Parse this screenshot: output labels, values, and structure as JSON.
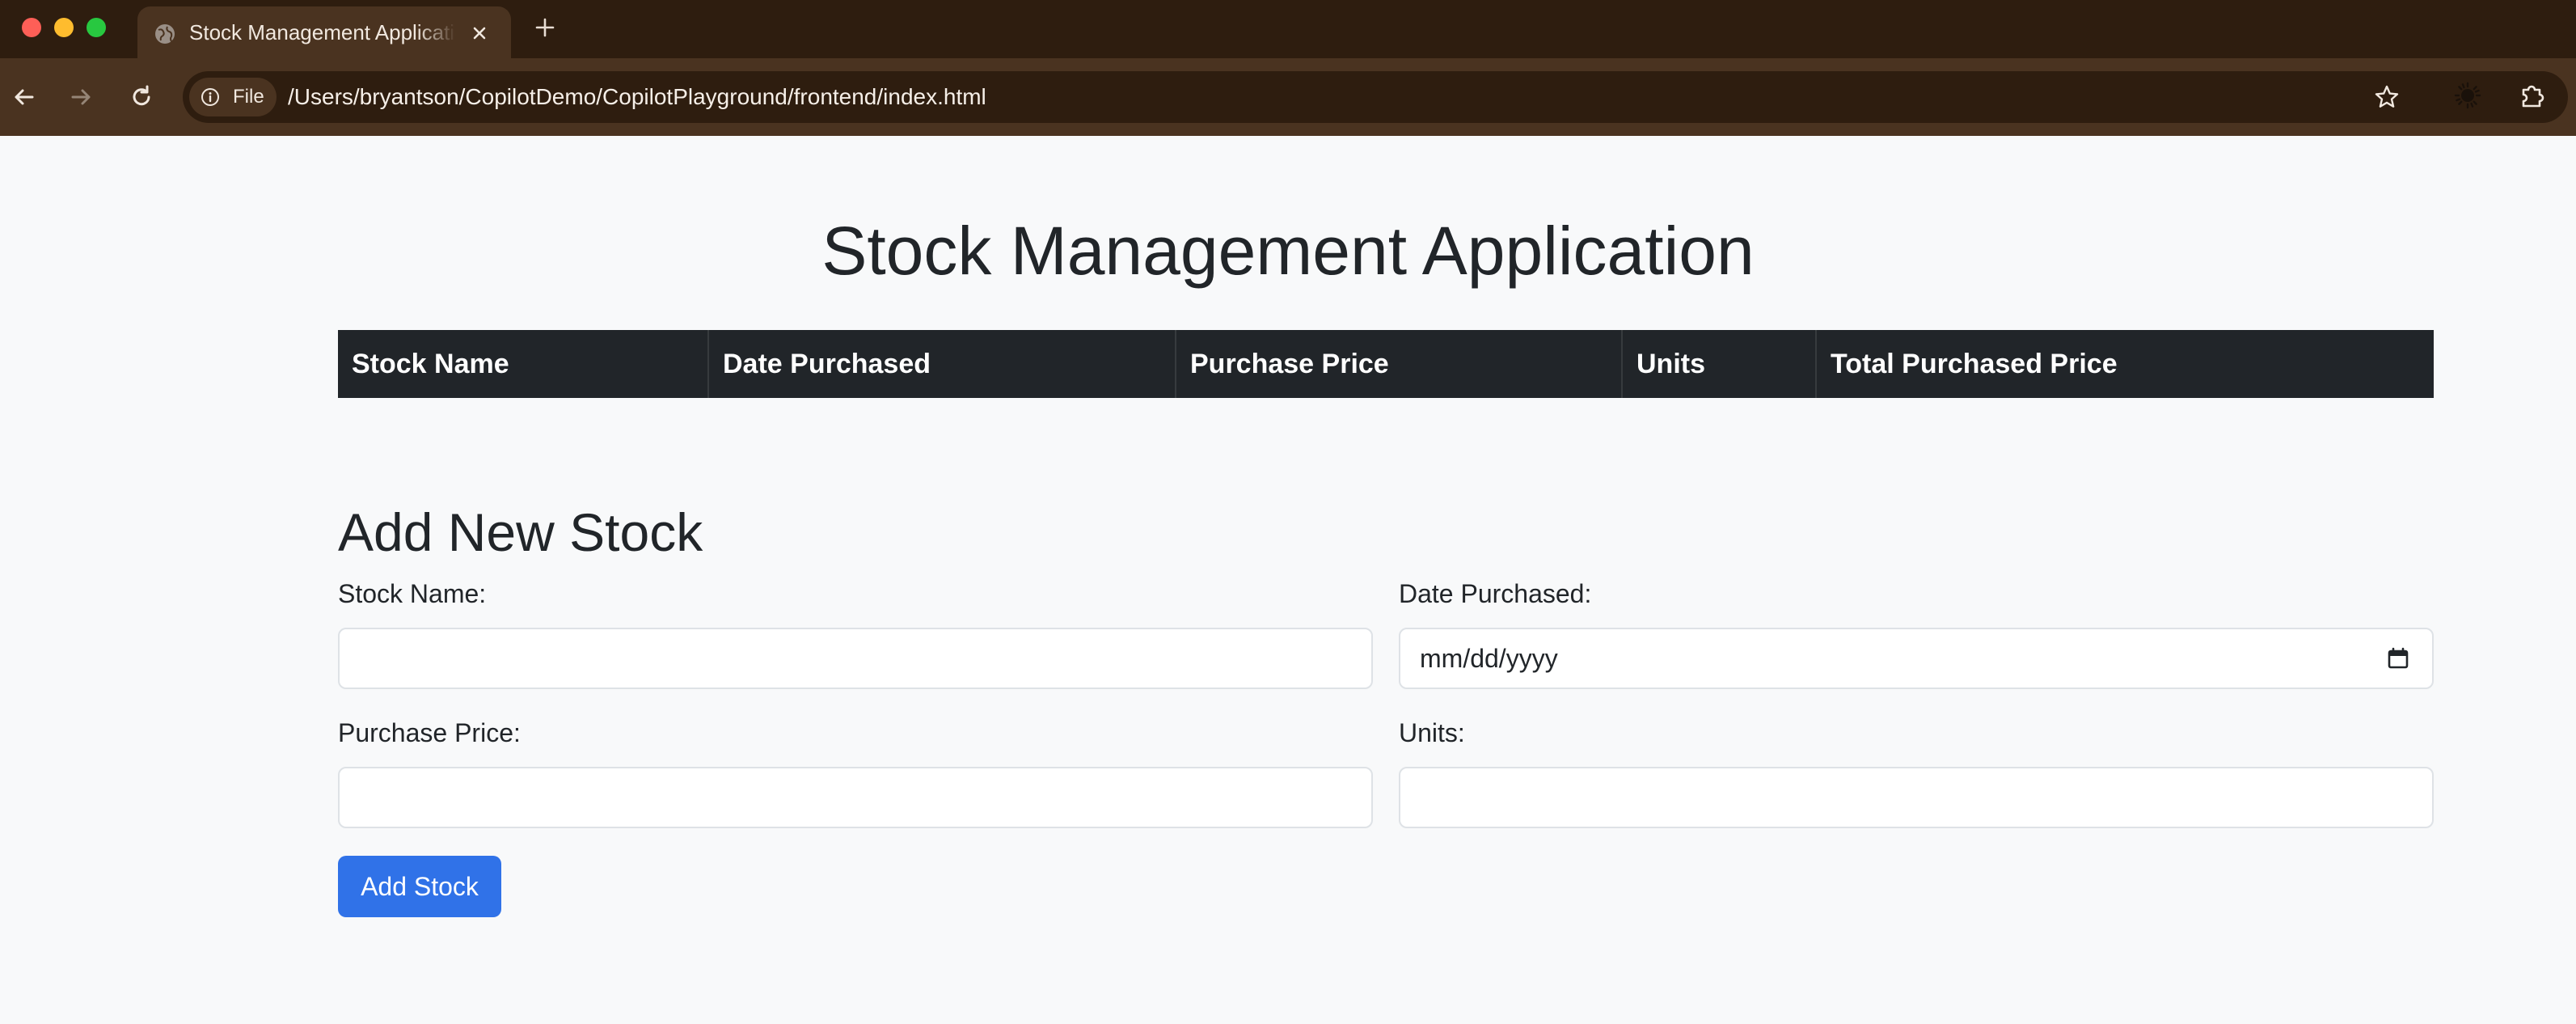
{
  "browser": {
    "tab_title": "Stock Management Application",
    "new_tab_symbol": "+",
    "site_info_label": "File",
    "url": "/Users/bryantson/CopilotDemo/CopilotPlayground/frontend/index.html"
  },
  "page": {
    "title": "Stock Management Application",
    "table": {
      "columns": [
        "Stock Name",
        "Date Purchased",
        "Purchase Price",
        "Units",
        "Total Purchased Price"
      ],
      "rows": []
    },
    "form": {
      "heading": "Add New Stock",
      "stock_name_label": "Stock Name:",
      "stock_name_value": "",
      "date_purchased_label": "Date Purchased:",
      "date_purchased_placeholder": "mm/dd/yyyy",
      "purchase_price_label": "Purchase Price:",
      "purchase_price_value": "",
      "units_label": "Units:",
      "units_value": "",
      "submit_label": "Add Stock"
    }
  },
  "colors": {
    "table_header_bg": "#212529",
    "primary_button": "#3072e8",
    "page_bg": "#f8f9fa",
    "browser_frame": "#2e1d0f",
    "browser_toolbar": "#4a3320"
  },
  "icons": [
    "globe-icon",
    "close-icon",
    "plus-icon",
    "back-arrow-icon",
    "forward-arrow-icon",
    "reload-icon",
    "info-icon",
    "star-icon",
    "extension-sun-icon",
    "puzzle-icon",
    "calendar-icon"
  ]
}
